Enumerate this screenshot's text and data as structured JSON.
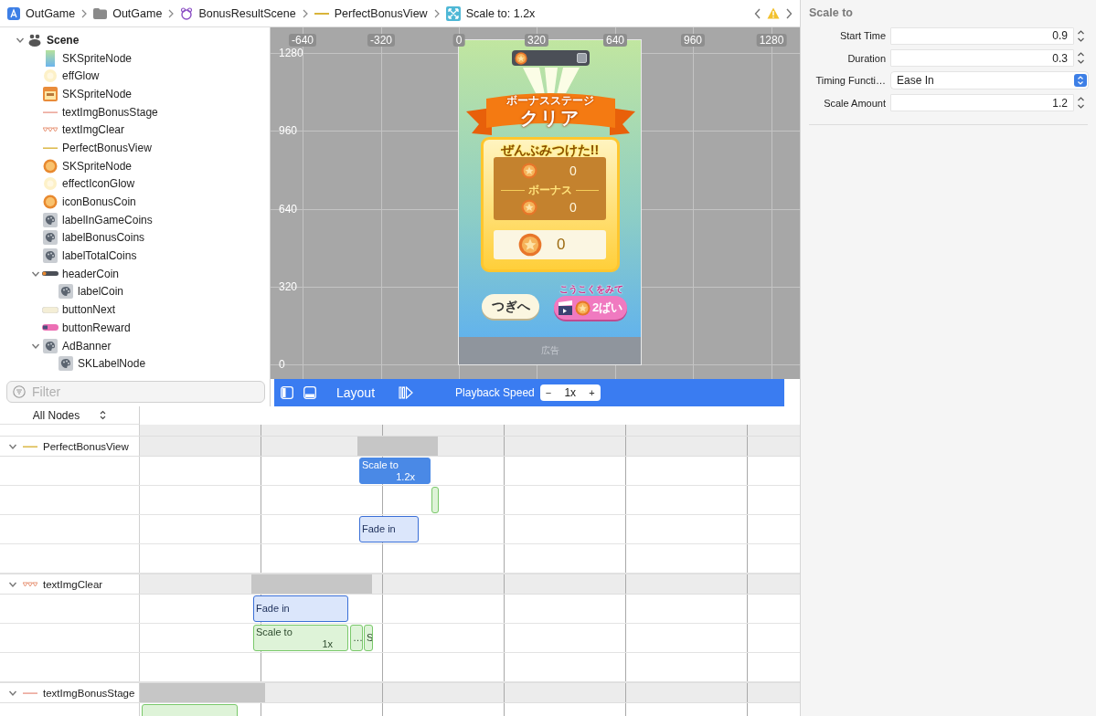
{
  "breadcrumb": [
    {
      "label": "OutGame",
      "kind": "project"
    },
    {
      "label": "OutGame",
      "kind": "folder"
    },
    {
      "label": "BonusResultScene",
      "kind": "scene"
    },
    {
      "label": "PerfectBonusView",
      "kind": "node"
    },
    {
      "label": "Scale to: 1.2x",
      "kind": "action"
    }
  ],
  "outline": {
    "items": [
      {
        "name": "Scene",
        "kind": "scene",
        "expanded": true,
        "children": [
          {
            "name": "SKSpriteNode",
            "kind": "gradient"
          },
          {
            "name": "effGlow",
            "kind": "glow"
          },
          {
            "name": "SKSpriteNode",
            "kind": "board"
          },
          {
            "name": "textImgBonusStage",
            "kind": "line-red"
          },
          {
            "name": "textImgClear",
            "kind": "hearts"
          },
          {
            "name": "PerfectBonusView",
            "kind": "line-yellow"
          },
          {
            "name": "SKSpriteNode",
            "kind": "coin"
          },
          {
            "name": "effectIconGlow",
            "kind": "glow"
          },
          {
            "name": "iconBonusCoin",
            "kind": "coin"
          },
          {
            "name": "labelInGameCoins",
            "kind": "label"
          },
          {
            "name": "labelBonusCoins",
            "kind": "label"
          },
          {
            "name": "labelTotalCoins",
            "kind": "label"
          },
          {
            "name": "headerCoin",
            "kind": "bar",
            "expanded": true,
            "children": [
              {
                "name": "labelCoin",
                "kind": "label"
              }
            ]
          },
          {
            "name": "buttonNext",
            "kind": "pill-cream"
          },
          {
            "name": "buttonReward",
            "kind": "pill-pink"
          },
          {
            "name": "AdBanner",
            "kind": "label",
            "expanded": true,
            "children": [
              {
                "name": "SKLabelNode",
                "kind": "label"
              }
            ]
          }
        ]
      }
    ]
  },
  "filter": {
    "placeholder": "Filter"
  },
  "canvas": {
    "x_ruler": [
      "-640",
      "-320",
      "0",
      "320",
      "640",
      "960",
      "1280"
    ],
    "y_ruler": [
      "1280",
      "960",
      "640",
      "320",
      "0"
    ],
    "game": {
      "ribbon_top": "ボーナスステージ",
      "ribbon_main": "クリア",
      "headline": "ぜんぶみつけた!!",
      "coin_rows": [
        "0",
        "0"
      ],
      "bonus_label": "ボーナス",
      "total": "0",
      "next_button": "つぎへ",
      "reward_caption": "こうこくをみて",
      "reward_button": "2ばい",
      "ad_label": "広告"
    }
  },
  "toolbar": {
    "layout": "Layout",
    "playback": "Playback Speed",
    "minus": "−",
    "speed": "1x",
    "plus": "+"
  },
  "timeline": {
    "filter": "All Nodes",
    "groups": [
      {
        "name": "PerfectBonusView",
        "kind": "line-yellow",
        "expanded": true,
        "tracks": [
          [
            {
              "kind": "scale",
              "label": "Scale to",
              "value": "1.2x",
              "selected": true
            }
          ],
          [
            {
              "kind": "scale",
              "selected": false
            }
          ],
          [
            {
              "kind": "fade",
              "label": "Fade in",
              "selected": false
            }
          ]
        ]
      },
      {
        "name": "textImgClear",
        "kind": "hearts",
        "expanded": true,
        "tracks": [
          [
            {
              "kind": "fade",
              "label": "Fade in",
              "selected": false
            }
          ],
          [
            {
              "kind": "scale",
              "label": "Scale to",
              "value": "1x",
              "selected": false
            },
            {
              "kind": "scale",
              "label": "…",
              "selected": false
            },
            {
              "kind": "scale",
              "label": "S",
              "selected": false
            }
          ]
        ]
      },
      {
        "name": "textImgBonusStage",
        "kind": "line-red",
        "expanded": true,
        "tracks": [
          [
            {
              "kind": "scale",
              "selected": false
            }
          ]
        ]
      }
    ]
  },
  "inspector": {
    "title": "Scale to",
    "fields": [
      {
        "label": "Start Time",
        "value": "0.9",
        "kind": "stepper"
      },
      {
        "label": "Duration",
        "value": "0.3",
        "kind": "stepper"
      },
      {
        "label": "Timing Functi…",
        "value": "Ease In",
        "kind": "popup"
      },
      {
        "label": "Scale Amount",
        "value": "1.2",
        "kind": "stepper"
      }
    ]
  }
}
